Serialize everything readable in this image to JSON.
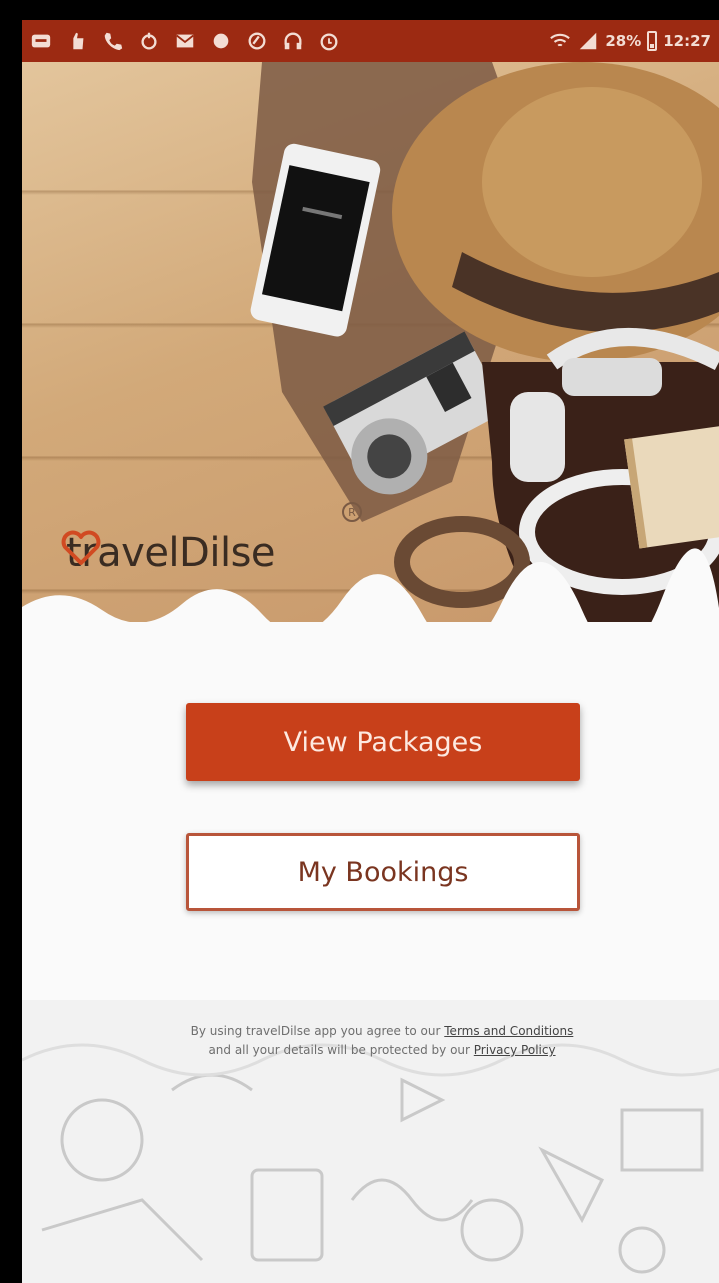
{
  "status_bar": {
    "battery": "28%",
    "time": "12:27",
    "icons": [
      "message-icon",
      "hand-icon",
      "phone-icon",
      "sync-icon",
      "mail-icon",
      "record-icon",
      "browser-icon",
      "headphone-icon",
      "alarm-icon",
      "wifi-icon",
      "signal-icon",
      "battery-icon"
    ]
  },
  "hero": {
    "brand": "travelDilse",
    "registered_mark": "R"
  },
  "actions": {
    "view_packages": "View Packages",
    "my_bookings": "My Bookings"
  },
  "legal": {
    "line1_prefix": "By using travelDilse app you agree to our",
    "terms_link": "Terms and Conditions",
    "line2_prefix": "and all your details will be protected by our",
    "privacy_link": "Privacy Policy"
  },
  "colors": {
    "status_bar": "#9c2a12",
    "accent": "#c8401a",
    "outline": "#b8553a"
  }
}
